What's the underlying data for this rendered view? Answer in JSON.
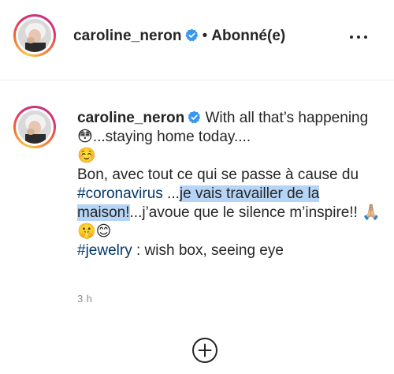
{
  "header": {
    "username": "caroline_neron",
    "separator": "•",
    "follow_status": "Abonné(e)"
  },
  "caption": {
    "username": "caroline_neron",
    "line1_text": "With all that’s happening",
    "emoji_flushed": "😳",
    "text_after_emoji": "...staying home today....",
    "emoji_smiling": "☺️",
    "text_french_1": "Bon, avec tout ce qui se passe à cause du ",
    "hashtag_coronavirus": "#coronavirus",
    "text_ellipsis": " ...",
    "text_highlighted": "je vais travailler de la maison!",
    "text_french_2": "...j’avoue que le silence m’inspire!! ",
    "emoji_pray": "🙏🏼",
    "emoji_shush": "🤫",
    "emoji_smile": "😊",
    "hashtag_jewelry": "#jewelry",
    "text_end": " : wish box, seeing eye"
  },
  "timestamp": "3 h",
  "icons": {
    "verified": "verified-badge-icon",
    "more": "more-options-icon",
    "load_more": "plus-circle-icon"
  },
  "colors": {
    "verified_blue": "#3897f0",
    "hashtag_blue": "#00376b",
    "highlight": "#b5d4f6",
    "muted_text": "#8e8e8e"
  }
}
